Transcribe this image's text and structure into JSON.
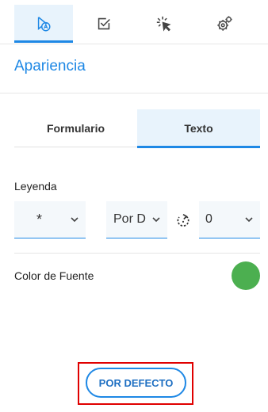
{
  "top_tabs": [
    {
      "icon": "appearance-icon",
      "active": true
    },
    {
      "icon": "checkbox-icon",
      "active": false
    },
    {
      "icon": "click-icon",
      "active": false
    },
    {
      "icon": "settings-icon",
      "active": false
    }
  ],
  "section_title": "Apariencia",
  "sub_tabs": [
    {
      "label": "Formulario",
      "active": false
    },
    {
      "label": "Texto",
      "active": true
    }
  ],
  "leyenda": {
    "label": "Leyenda",
    "symbol_select": "*",
    "position_select": "Por D",
    "rotation_select": "0"
  },
  "font_color": {
    "label": "Color de Fuente",
    "color": "#4caf50"
  },
  "default_button": "POR DEFECTO",
  "colors": {
    "accent": "#1e88e5",
    "active_bg": "#e8f3fc",
    "highlight": "#e00000"
  }
}
